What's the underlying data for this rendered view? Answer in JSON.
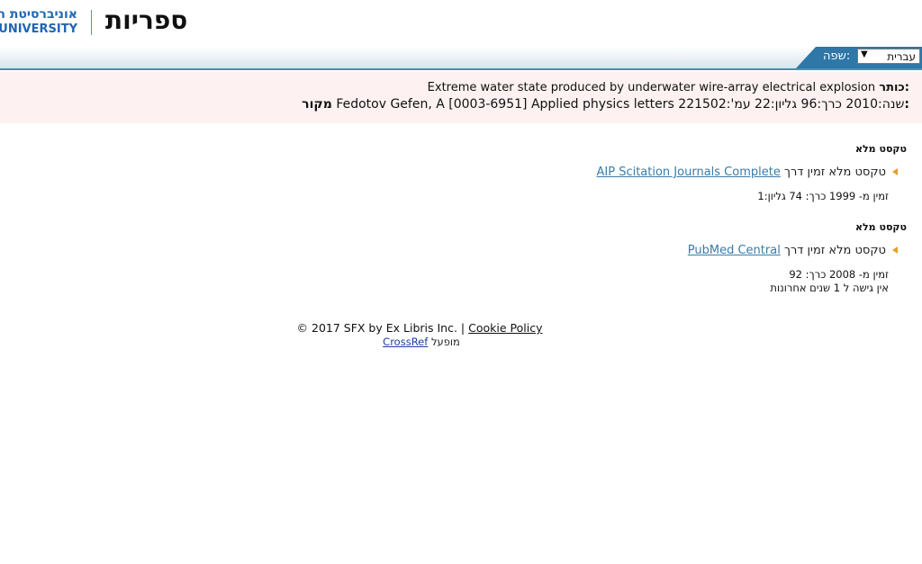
{
  "header": {
    "logo_hebrew": "אוניברסיטת ה",
    "logo_english": "UNIVERSITY",
    "title": "ספריות"
  },
  "language": {
    "label": ":שפה",
    "selected": "עברית",
    "tab_color": "#2e77a7"
  },
  "citation": {
    "title_label": "כותר:",
    "title_value": "Extreme water state produced by underwater wire-array electrical explosion",
    "source_label": "מקור:",
    "source_value": "שנה:2010 כרך:96 גליון:22 עמ':221502 Fedotov Gefen, A [0003-6951] Applied physics letters"
  },
  "services": [
    {
      "section_title": "טקסט מלא",
      "prefix": "טקסט מלא זמין דרך",
      "link": "AIP Scitation Journals Complete",
      "coverage": [
        "זמין מ- 1999 כרך: 74 גליון:1"
      ]
    },
    {
      "section_title": "טקסט מלא",
      "prefix": "טקסט מלא זמין דרך",
      "link": "PubMed Central",
      "coverage": [
        "זמין מ- 2008 כרך: 92",
        "אין גישה ל 1 שנים אחרונות"
      ]
    }
  ],
  "footer": {
    "copyright": "© 2017 SFX by Ex Libris Inc. |",
    "cookie_policy": "Cookie Policy",
    "powered_by": "מופעל",
    "crossref": "CrossRef"
  }
}
